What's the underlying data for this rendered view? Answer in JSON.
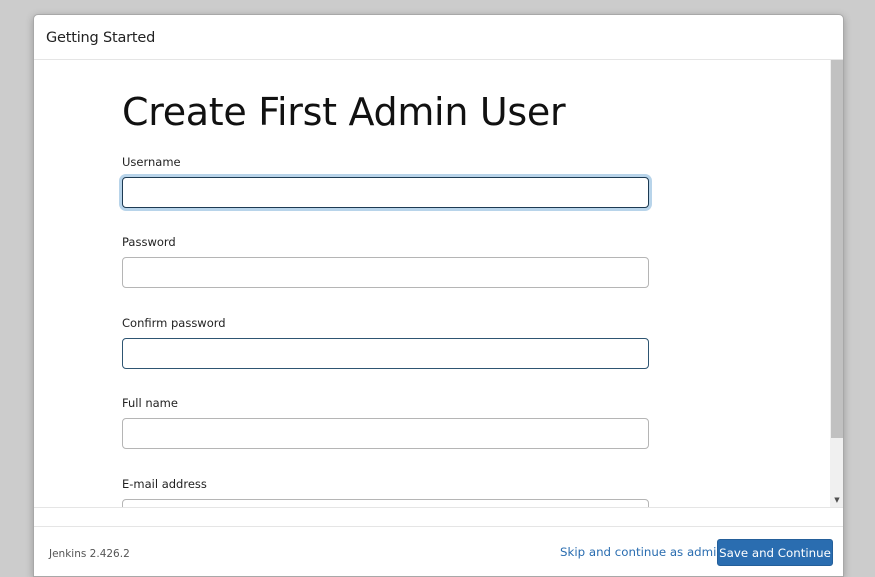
{
  "dialog": {
    "title": "Getting Started"
  },
  "form": {
    "heading": "Create First Admin User",
    "fields": [
      {
        "label": "Username",
        "value": "",
        "type": "text"
      },
      {
        "label": "Password",
        "value": "",
        "type": "password"
      },
      {
        "label": "Confirm password",
        "value": "",
        "type": "password"
      },
      {
        "label": "Full name",
        "value": "",
        "type": "text"
      },
      {
        "label": "E-mail address",
        "value": "",
        "type": "email"
      }
    ]
  },
  "footer": {
    "version": "Jenkins 2.426.2",
    "skip_label": "Skip and continue as admin",
    "save_label": "Save and Continue"
  },
  "colors": {
    "accent": "#2a6db0",
    "focus_ring": "#b8d4ea",
    "backdrop": "#cccccc"
  }
}
